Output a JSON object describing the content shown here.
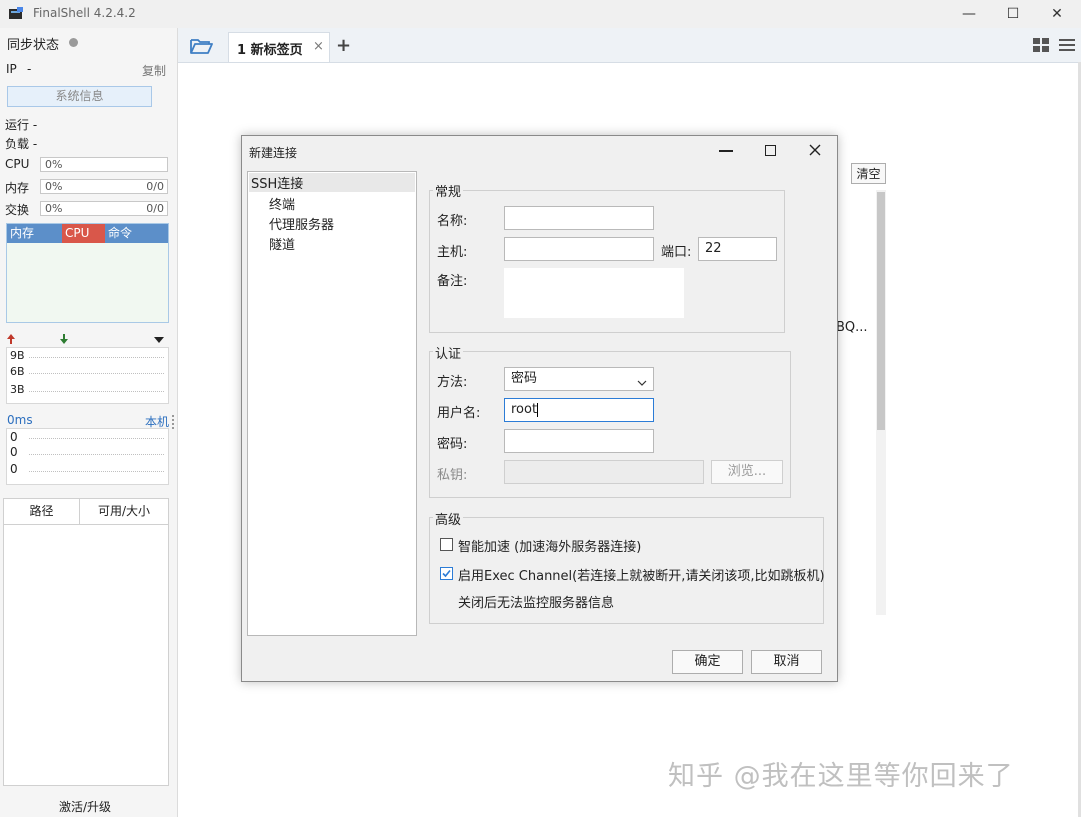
{
  "app": {
    "title": "FinalShell 4.2.4.2"
  },
  "window_controls": {
    "minimize": "—",
    "maximize": "☐",
    "close": "✕"
  },
  "sidebar": {
    "sync_status": "同步状态",
    "ip_label": "IP",
    "ip_value": "-",
    "copy": "复制",
    "sys_info_button": "系统信息",
    "run_label": "运行 -",
    "load_label": "负载 -",
    "cpu": {
      "label": "CPU",
      "value": "0%"
    },
    "mem": {
      "label": "内存",
      "value": "0%",
      "detail": "0/0"
    },
    "swap": {
      "label": "交换",
      "value": "0%",
      "detail": "0/0"
    },
    "process_columns": [
      "内存",
      "CPU",
      "命令"
    ],
    "net_rows": [
      "9B",
      "6B",
      "3B"
    ],
    "ping_label": "0ms",
    "ping_target": "本机",
    "ping_rows": [
      "0",
      "0",
      "0"
    ],
    "disk_columns": [
      "路径",
      "可用/大小"
    ],
    "activate": "激活/升级"
  },
  "tabs": [
    {
      "label": "1 新标签页",
      "close": "×"
    }
  ],
  "tab_add": "+",
  "background": {
    "clear_button": "清空",
    "truncated_text": "BQ..."
  },
  "dialog": {
    "title": "新建连接",
    "tree": {
      "root": "SSH连接",
      "children": [
        "终端",
        "代理服务器",
        "隧道"
      ]
    },
    "general": {
      "group_label": "常规",
      "name_label": "名称:",
      "name_value": "",
      "host_label": "主机:",
      "host_value": "",
      "port_label": "端口:",
      "port_value": "22",
      "note_label": "备注:",
      "note_value": ""
    },
    "auth": {
      "group_label": "认证",
      "method_label": "方法:",
      "method_value": "密码",
      "username_label": "用户名:",
      "username_value": "root",
      "password_label": "密码:",
      "password_value": "",
      "key_label": "私钥:",
      "browse_button": "浏览..."
    },
    "advanced": {
      "group_label": "高级",
      "smart_accel": {
        "label": "智能加速 (加速海外服务器连接)",
        "checked": false
      },
      "exec_channel": {
        "label": "启用Exec Channel(若连接上就被断开,请关闭该项,比如跳板机)",
        "checked": true
      },
      "exec_note": "关闭后无法监控服务器信息"
    },
    "ok_button": "确定",
    "cancel_button": "取消"
  },
  "watermark": "知乎 @我在这里等你回来了",
  "colors": {
    "accent": "#2c7cd6",
    "process_header": "#5c8fc9",
    "cpu_header": "#d9574a",
    "upload_arrow": "#c0392b",
    "download_arrow": "#2e7d32"
  }
}
